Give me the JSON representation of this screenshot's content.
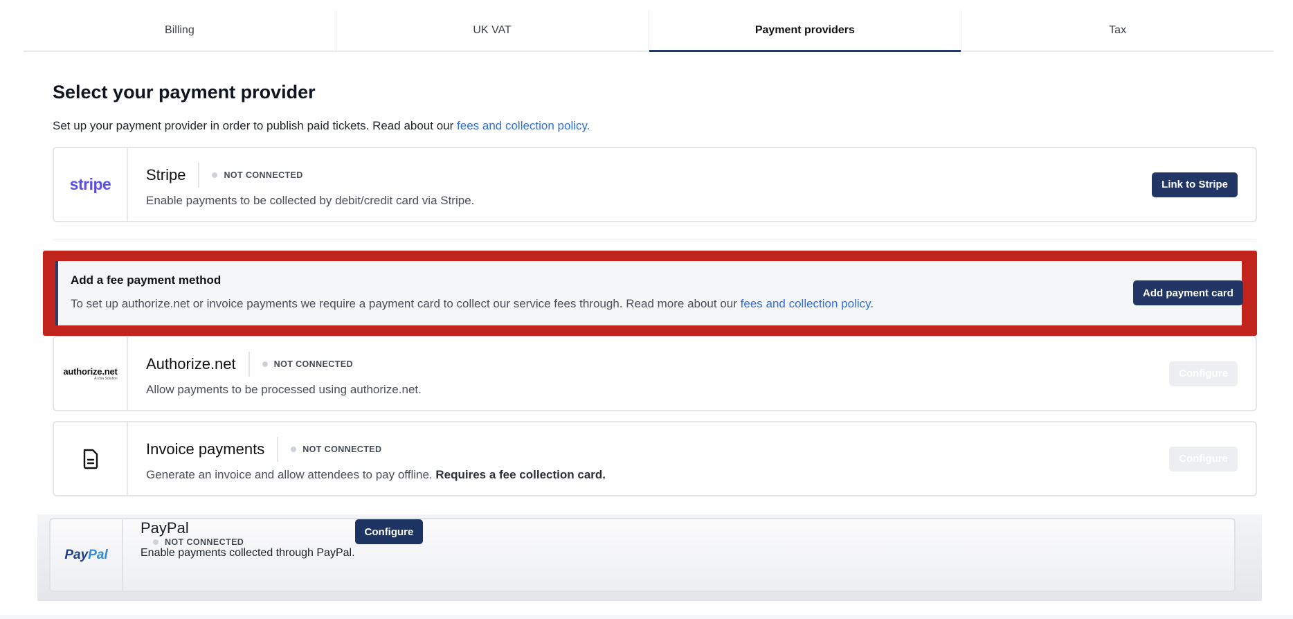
{
  "tabs": [
    {
      "label": "Billing",
      "active": false
    },
    {
      "label": "UK VAT",
      "active": false
    },
    {
      "label": "Payment providers",
      "active": true
    },
    {
      "label": "Tax",
      "active": false
    }
  ],
  "page": {
    "title": "Select your payment provider",
    "subtitle_text": "Set up your payment provider in order to publish paid tickets. Read about our ",
    "subtitle_link": "fees and collection policy."
  },
  "providers": {
    "stripe": {
      "logo_text": "stripe",
      "name": "Stripe",
      "status": "NOT CONNECTED",
      "description": "Enable payments to be collected by debit/credit card via Stripe.",
      "button": "Link to Stripe"
    },
    "authorize": {
      "logo_text": "authorize.net",
      "logo_subtext": "A Visa Solution",
      "name": "Authorize.net",
      "status": "NOT CONNECTED",
      "description": "Allow payments to be processed using authorize.net.",
      "button": "Configure"
    },
    "invoice": {
      "icon": "document-icon",
      "name": "Invoice payments",
      "status": "NOT CONNECTED",
      "description": "Generate an invoice and allow attendees to pay offline. ",
      "description_bold": "Requires a fee collection card.",
      "button": "Configure"
    },
    "paypal": {
      "logo_text_pay": "Pay",
      "logo_text_pal": "Pal",
      "name": "PayPal",
      "status": "NOT CONNECTED",
      "description": "Enable payments collected through PayPal.",
      "button": "Configure"
    }
  },
  "fee_notice": {
    "title": "Add a fee payment method",
    "description": "To set up authorize.net or invoice payments we require a payment card to collect our service fees through. Read more about our ",
    "link": "fees and collection policy",
    "trailing": ".",
    "button": "Add payment card"
  },
  "colors": {
    "primary_button": "#213664",
    "highlight": "#c0241c",
    "link": "#2f6fe0",
    "stripe_brand": "#5b4fe0"
  }
}
